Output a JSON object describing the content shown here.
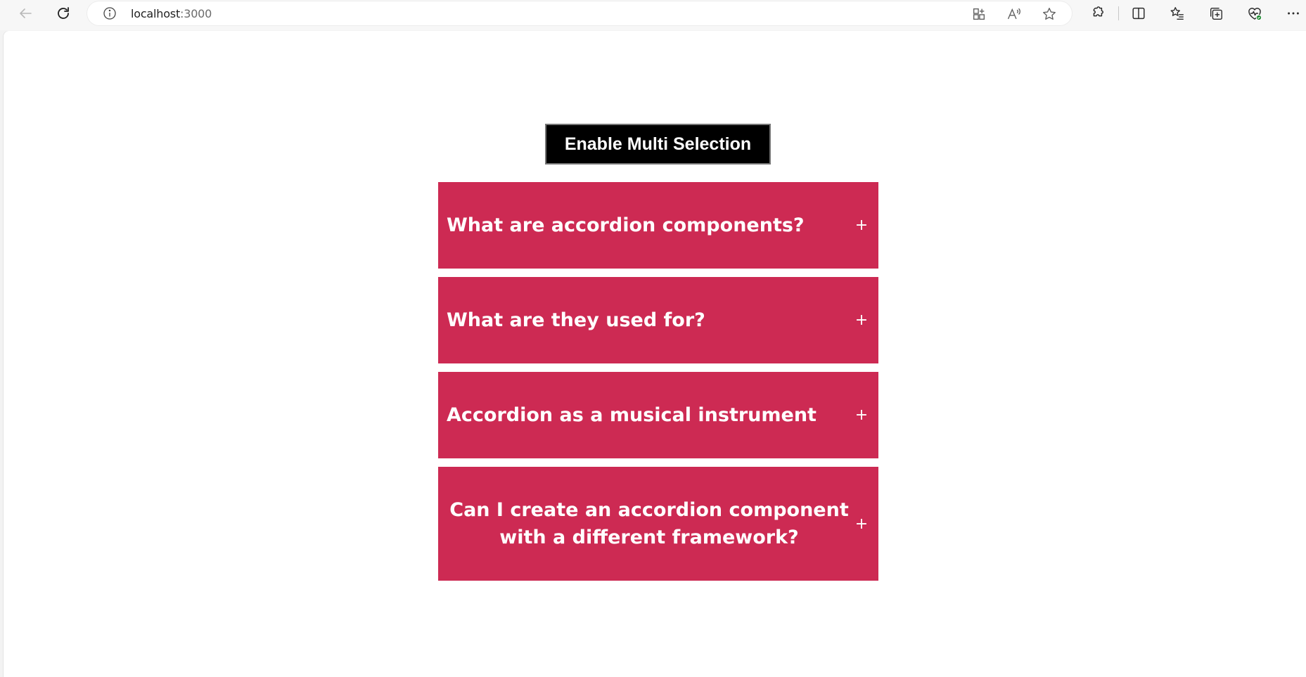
{
  "browser": {
    "url_host": "localhost",
    "url_port": ":3000",
    "icons": {
      "back": "arrow-left-icon",
      "reload": "reload-icon",
      "info": "info-icon",
      "apps": "app-grid-icon",
      "read_aloud": "read-aloud-icon",
      "favorite": "star-icon",
      "extensions": "puzzle-icon",
      "split": "split-screen-icon",
      "favorites": "favorites-list-icon",
      "collections": "collections-icon",
      "health": "browser-essentials-icon",
      "more": "more-icon"
    }
  },
  "page": {
    "multi_selection_label": "Enable Multi Selection",
    "accordion": [
      {
        "title": "What are accordion components?",
        "toggle": "+"
      },
      {
        "title": "What are they used for?",
        "toggle": "+"
      },
      {
        "title": "Accordion as a musical instrument",
        "toggle": "+"
      },
      {
        "title": "Can I create an accordion component with a different framework?",
        "toggle": "+"
      }
    ]
  },
  "colors": {
    "accordion_bg": "#cd2a53",
    "button_bg": "#000000",
    "text": "#ffffff"
  }
}
